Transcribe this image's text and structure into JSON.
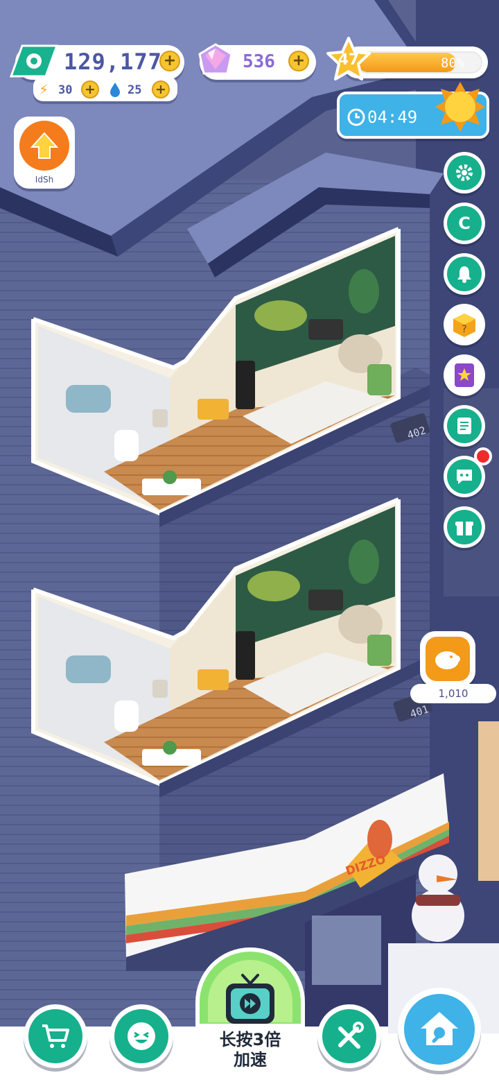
{
  "hud": {
    "cash": "129,177",
    "energy": "30",
    "water": "25",
    "gems": "536",
    "level": "47",
    "level_progress_text": "80%",
    "level_progress": 0.8,
    "timer": "04:49",
    "boost_label": "IdSh"
  },
  "building": {
    "room_upper_number": "402",
    "room_lower_number": "401",
    "shop_sign": "DIZZO"
  },
  "piggy_bank": {
    "value": "1,010"
  },
  "side_menu": {
    "items": [
      "gear-icon",
      "coupon-icon",
      "bell-icon",
      "mystery-box-icon",
      "star-book-icon",
      "notes-icon",
      "chat-icon",
      "gift-icon"
    ]
  },
  "bottom_bar": {
    "speed_label_line1": "长按3倍",
    "speed_label_line2": "加速"
  },
  "colors": {
    "accent_teal": "#16b08d",
    "coin_yellow": "#f5c531",
    "level_bar": "#f7a823",
    "timer_blue": "#3fb2e8",
    "night_wall": "#5b6491"
  }
}
